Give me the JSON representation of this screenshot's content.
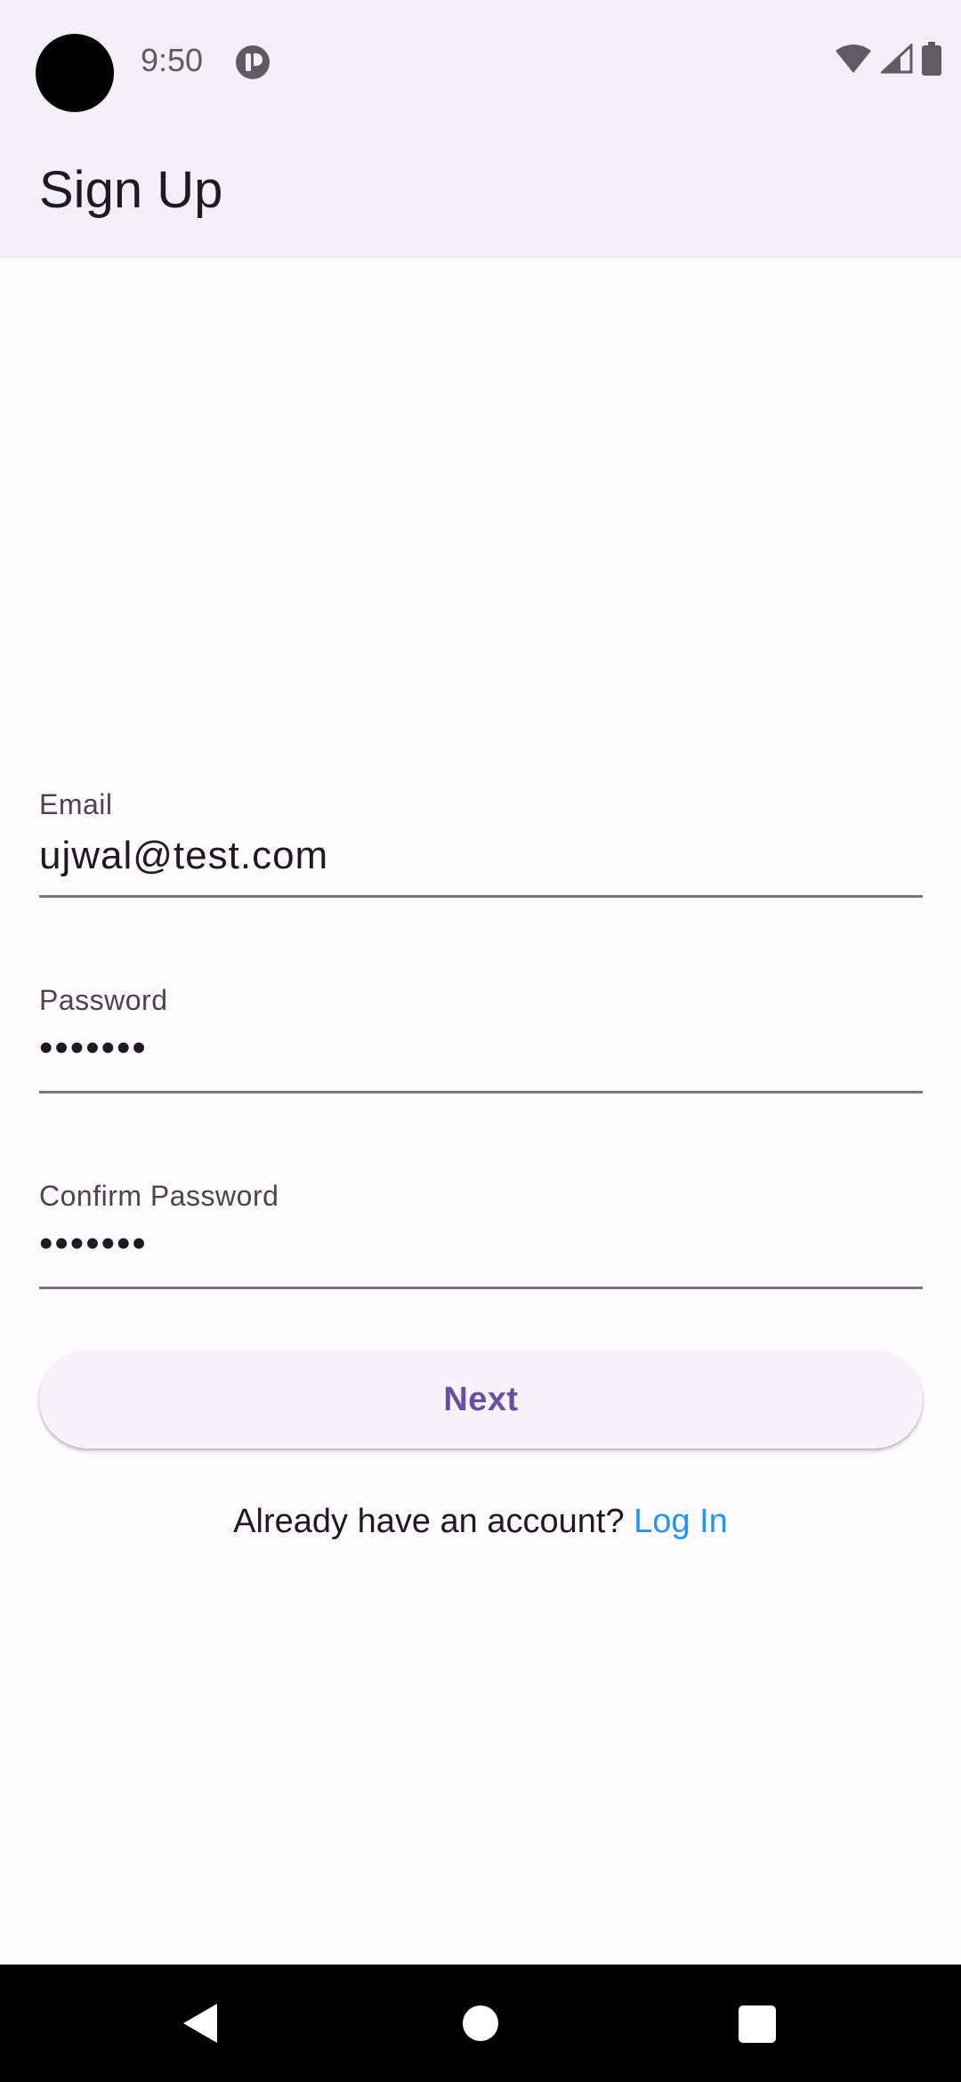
{
  "status_bar": {
    "time": "9:50",
    "app_icon": "pause-circle-icon",
    "icons": [
      "wifi-icon",
      "cellular-signal-icon",
      "battery-icon"
    ]
  },
  "app_bar": {
    "title": "Sign Up"
  },
  "form": {
    "email": {
      "label": "Email",
      "value": "ujwal@test.com"
    },
    "password": {
      "label": "Password",
      "value": "•••••••"
    },
    "confirm_password": {
      "label": "Confirm Password",
      "value": "•••••••"
    }
  },
  "next_button": {
    "label": "Next"
  },
  "login_prompt": {
    "text": "Already have an account? ",
    "link_label": "Log In"
  },
  "nav_bar": {
    "icons": [
      "back-icon",
      "home-icon",
      "recents-icon"
    ]
  },
  "colors": {
    "accent": "#6750A4",
    "link": "#2196F3",
    "surface": "#F3EEF8",
    "background": "#FFFBFE"
  }
}
